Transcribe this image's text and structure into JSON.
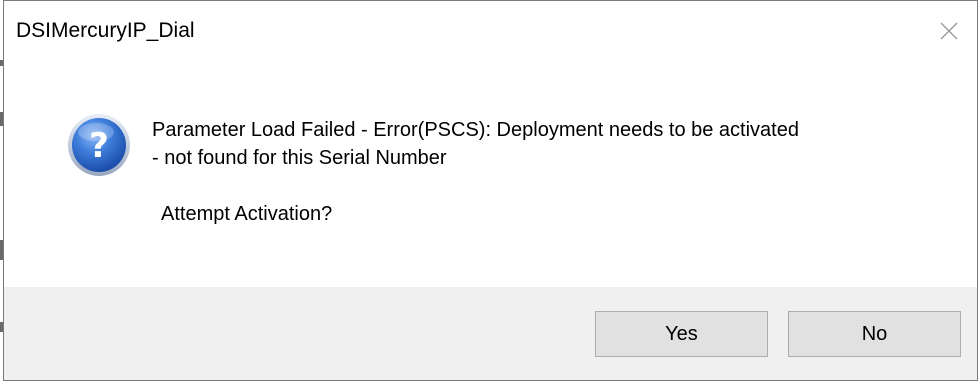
{
  "dialog": {
    "title": "DSIMercuryIP_Dial",
    "close_icon": "close-icon",
    "icon": "question-icon",
    "message_line_1": "Parameter Load Failed - Error(PSCS): Deployment needs to be activated",
    "message_line_2": "- not found for this Serial Number",
    "prompt": "Attempt Activation?",
    "buttons": {
      "yes_label": "Yes",
      "no_label": "No"
    }
  },
  "colors": {
    "footer_background": "#f0f0f0",
    "button_background": "#e1e1e1",
    "button_border": "#adadad",
    "dialog_border": "#7a7a7a",
    "icon_blue": "#2a63c8"
  }
}
